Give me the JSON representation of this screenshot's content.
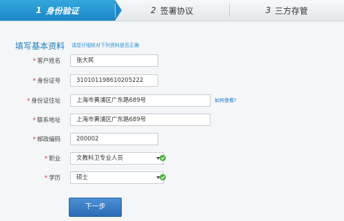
{
  "steps": [
    {
      "num": "1",
      "label": "身份验证",
      "active": true
    },
    {
      "num": "2",
      "label": "签署协议",
      "active": false
    },
    {
      "num": "3",
      "label": "三方存管",
      "active": false
    }
  ],
  "section": {
    "title": "填写基本资料",
    "hint": "请您仔细核对下列资料是否正确"
  },
  "required_mark": "*",
  "form": {
    "name": {
      "label": "客户姓名",
      "value": "张大民"
    },
    "id_number": {
      "label": "身份证号",
      "value": "310101198610205222"
    },
    "id_address": {
      "label": "身份证住址",
      "value": "上海市黄浦区广东路689号",
      "help": "如何查看?"
    },
    "contact_address": {
      "label": "联系地址",
      "value": "上海市黄浦区广东路689号"
    },
    "postal_code": {
      "label": "邮政编码",
      "value": "200002"
    },
    "occupation": {
      "label": "职业",
      "value": "文教科卫专业人员"
    },
    "education": {
      "label": "学历",
      "value": "硕士"
    }
  },
  "colors": {
    "accent": "#1c86c6",
    "required": "#d62b2b",
    "valid": "#4cae3c"
  },
  "icons": {
    "valid": "check-circle-icon",
    "dropdown": "chevron-down-icon"
  },
  "buttons": {
    "next": "下一步"
  }
}
